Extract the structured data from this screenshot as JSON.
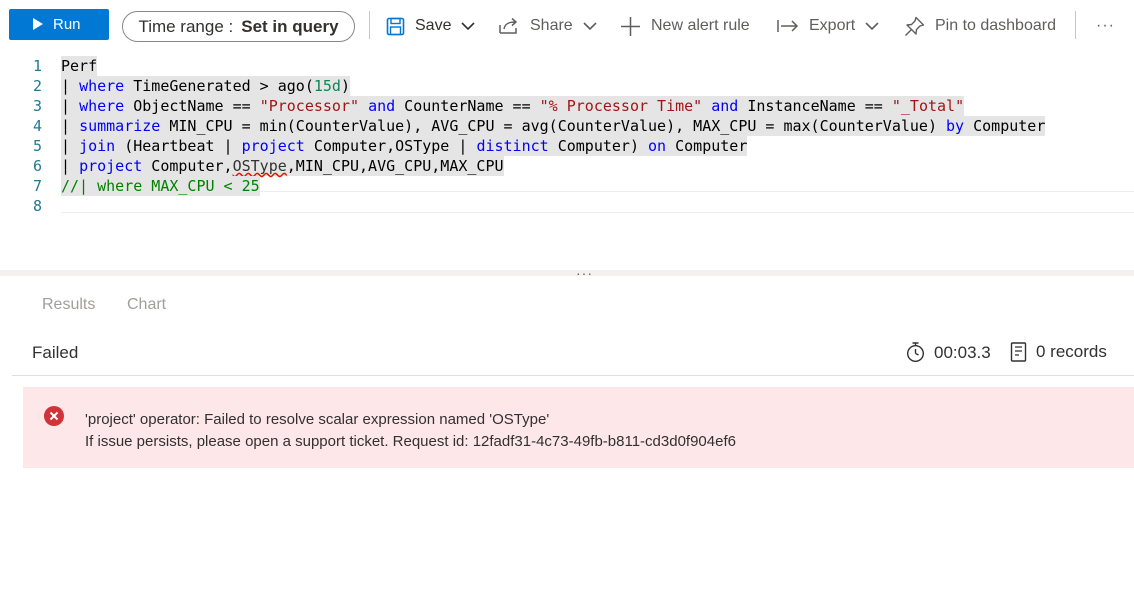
{
  "toolbar": {
    "run_label": "Run",
    "time_range_prefix": "Time range :",
    "time_range_value": "Set in query",
    "save_label": "Save",
    "share_label": "Share",
    "new_alert_label": "New alert rule",
    "export_label": "Export",
    "pin_label": "Pin to dashboard",
    "more_label": "···"
  },
  "editor": {
    "line_numbers": [
      "1",
      "2",
      "3",
      "4",
      "5",
      "6",
      "7",
      "8"
    ],
    "lines": [
      [
        [
          "plain",
          "Perf"
        ]
      ],
      [
        [
          "plain",
          "| "
        ],
        [
          "kw",
          "where"
        ],
        [
          "plain",
          " TimeGenerated > ago("
        ],
        [
          "num",
          "15d"
        ],
        [
          "plain",
          ")"
        ]
      ],
      [
        [
          "plain",
          "| "
        ],
        [
          "kw",
          "where"
        ],
        [
          "plain",
          " ObjectName == "
        ],
        [
          "str",
          "\"Processor\""
        ],
        [
          "plain",
          " "
        ],
        [
          "kw",
          "and"
        ],
        [
          "plain",
          " CounterName == "
        ],
        [
          "str",
          "\"% Processor Time\""
        ],
        [
          "plain",
          " "
        ],
        [
          "kw",
          "and"
        ],
        [
          "plain",
          " InstanceName == "
        ],
        [
          "str",
          "\"_Total\""
        ]
      ],
      [
        [
          "plain",
          "| "
        ],
        [
          "kw",
          "summarize"
        ],
        [
          "plain",
          " MIN_CPU = min(CounterValue), AVG_CPU = avg(CounterValue), MAX_CPU = max(CounterValue) "
        ],
        [
          "kw",
          "by"
        ],
        [
          "plain",
          " Computer"
        ]
      ],
      [
        [
          "plain",
          "| "
        ],
        [
          "kw",
          "join"
        ],
        [
          "plain",
          " (Heartbeat | "
        ],
        [
          "kw",
          "project"
        ],
        [
          "plain",
          " Computer,OSType | "
        ],
        [
          "kw",
          "distinct"
        ],
        [
          "plain",
          " Computer) "
        ],
        [
          "kw",
          "on"
        ],
        [
          "plain",
          " Computer"
        ]
      ],
      [
        [
          "plain",
          "| "
        ],
        [
          "kw",
          "project"
        ],
        [
          "plain",
          " Computer,"
        ],
        [
          "squig",
          "OSType"
        ],
        [
          "plain",
          ",MIN_CPU,AVG_CPU,MAX_CPU"
        ]
      ],
      [
        [
          "cmt",
          "//| where MAX_CPU < 25"
        ]
      ],
      []
    ]
  },
  "results": {
    "tab_results": "Results",
    "tab_chart": "Chart",
    "status": "Failed",
    "duration": "00:03.3",
    "records": "0 records",
    "splitter_dots": "···"
  },
  "error": {
    "line1": "'project' operator: Failed to resolve scalar expression named 'OSType'",
    "line2": "If issue persists, please open a support ticket. Request id: 12fadf31-4c73-49fb-b811-cd3d0f904ef6"
  },
  "colors": {
    "accent": "#0078d4",
    "error_bg": "#fde7e9",
    "error_icon": "#d13438",
    "keyword": "#0000ff",
    "string": "#a31515",
    "number": "#098658",
    "comment": "#008000"
  },
  "icons": [
    "play-icon",
    "save-icon",
    "share-icon",
    "plus-icon",
    "export-icon",
    "pin-icon",
    "timer-icon",
    "records-icon",
    "error-icon",
    "chevron-down-icon"
  ]
}
